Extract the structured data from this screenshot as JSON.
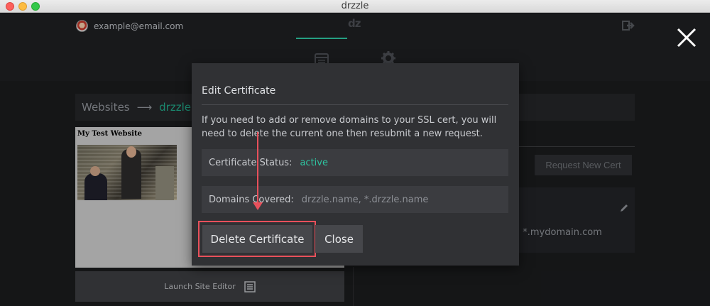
{
  "window": {
    "title": "drzzle"
  },
  "header": {
    "user_email": "example@email.com",
    "logo": "dz"
  },
  "page": {
    "breadcrumb": {
      "root": "Websites",
      "arrow": "⟶",
      "current": "drzzle"
    },
    "preview": {
      "site_title": "My Test Website"
    },
    "launch_label": "Launch Site Editor",
    "request_button": "Request New Cert",
    "cert_domains_partial": ", *.mydomain.com"
  },
  "modal": {
    "title": "Edit Certificate",
    "description": "If you need to add or remove domains to your SSL cert, you will need to delete the current one then resubmit a new request.",
    "status_label": "Certificate Status:",
    "status_value": "active",
    "domains_label": "Domains Covered:",
    "domains_value": "drzzle.name, *.drzzle.name",
    "delete_button": "Delete Certificate",
    "close_button": "Close"
  },
  "colors": {
    "accent": "#2ec4a0",
    "annotation": "#e8505b",
    "modal_bg": "#303134"
  },
  "icons": [
    "avatar",
    "logout-icon",
    "website-icon",
    "gear-icon",
    "launch-editor-icon",
    "pencil-icon",
    "close-icon"
  ]
}
